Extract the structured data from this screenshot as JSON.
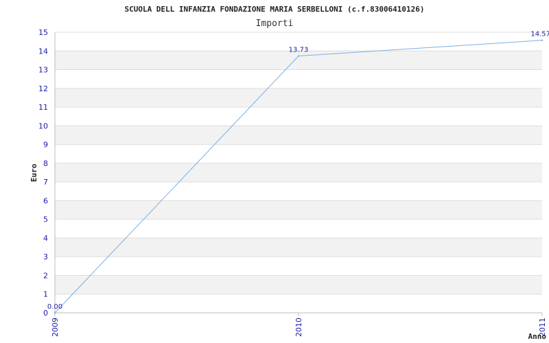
{
  "chart_data": {
    "type": "line",
    "title": "SCUOLA DELL INFANZIA FONDAZIONE MARIA SERBELLONI (c.f.83006410126)",
    "subtitle": "Importi",
    "xlabel": "Anno",
    "ylabel": "Euro",
    "categories": [
      "2009",
      "2010",
      "2011"
    ],
    "series": [
      {
        "values": [
          0.0,
          13.73,
          14.57
        ],
        "labels": [
          "0.00",
          "13.73",
          "14.57"
        ]
      }
    ],
    "ylim": [
      0,
      15
    ],
    "yticks": [
      "0",
      "1",
      "2",
      "3",
      "4",
      "5",
      "6",
      "7",
      "8",
      "9",
      "10",
      "11",
      "12",
      "13",
      "14",
      "15"
    ],
    "grid": true,
    "colors": {
      "line": "#7aaee6",
      "band": "#f2f2f2",
      "gridline": "#dddddd",
      "axis": "#bbbbbb",
      "tick_text": "#1a1aa6"
    }
  }
}
